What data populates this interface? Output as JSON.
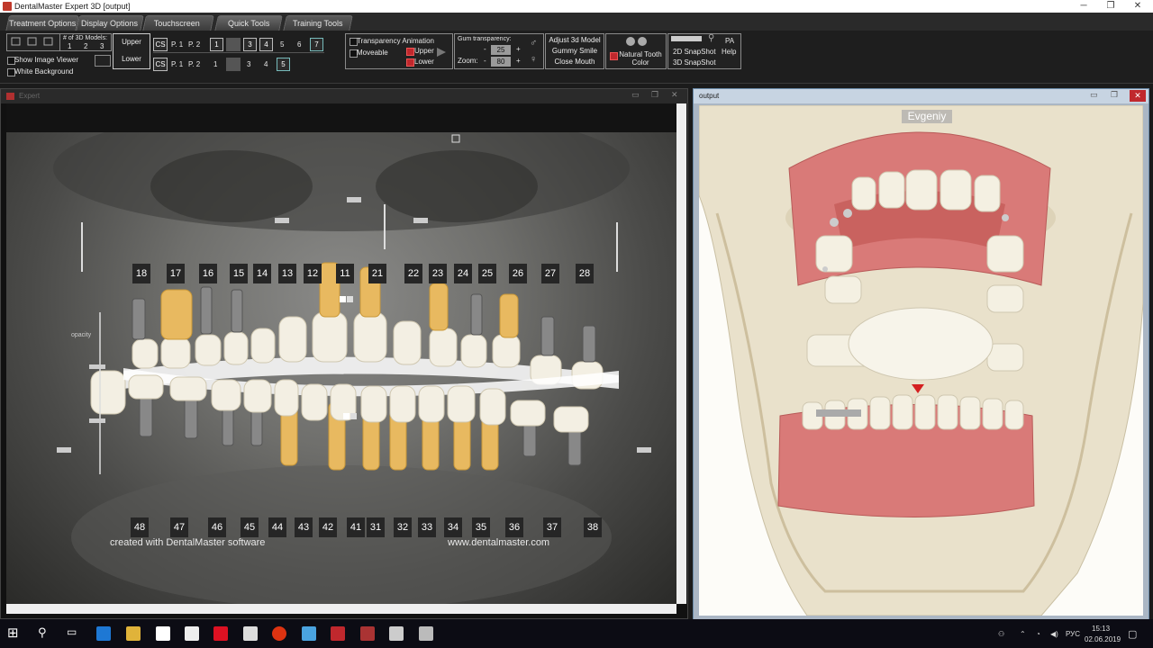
{
  "window": {
    "title": "DentalMaster Expert 3D [output]",
    "minimize": "─",
    "maximize": "❐",
    "close": "✕"
  },
  "tabs": [
    "Treatment Options",
    "Display Options",
    "Touchscreen Tools",
    "Quick Tools",
    "Training Tools"
  ],
  "toolbar": {
    "models_label": "# of 3D Models:",
    "models": [
      "1",
      "2",
      "3"
    ],
    "show_image_viewer": "Show Image Viewer",
    "white_background": "White Background",
    "upper": "Upper",
    "lower": "Lower",
    "row1": {
      "cs": "CS",
      "p1": "P. 1",
      "p2": "P. 2",
      "nums": [
        "1",
        "",
        "3",
        "4",
        "5",
        "6",
        "7"
      ]
    },
    "row2": {
      "cs": "CS",
      "p1": "P. 1",
      "p2": "P. 2",
      "nums": [
        "1",
        "",
        "3",
        "4",
        "5"
      ]
    },
    "transparency_animation": "Transparency Animation",
    "moveable": "Moveable",
    "anim_upper": "Upper",
    "anim_lower": "Lower",
    "gum_transparency": "Gum transparency:",
    "gum_value": "25",
    "zoom": "Zoom:",
    "zoom_value": "80",
    "minus": "-",
    "plus": "+",
    "adjust_3d": "Adjust 3d Model",
    "gummy_smile": "Gummy Smile",
    "close_mouth": "Close Mouth",
    "natural_tooth_color": "Natural Tooth Color",
    "pa": "PA",
    "snapshot_2d": "2D SnapShot",
    "snapshot_3d": "3D SnapShot",
    "help": "Help"
  },
  "left_window": {
    "title": "Expert",
    "opacity_label": "opacity",
    "upper_teeth": [
      "18",
      "17",
      "16",
      "15",
      "14",
      "13",
      "12",
      "11",
      "21",
      "22",
      "23",
      "24",
      "25",
      "26",
      "27",
      "28"
    ],
    "lower_teeth": [
      "48",
      "47",
      "46",
      "45",
      "44",
      "43",
      "42",
      "41",
      "31",
      "32",
      "33",
      "34",
      "35",
      "36",
      "37",
      "38"
    ],
    "watermark_left": "created with DentalMaster software",
    "watermark_right": "www.dentalmaster.com"
  },
  "right_window": {
    "title": "output",
    "patient_name": "Evgeniy"
  },
  "taskbar": {
    "time": "15:13",
    "date": "02.06.2019",
    "lang": "РУС"
  },
  "colors": {
    "accent_red": "#c0282d",
    "toolbar_bg": "#1e1e1e",
    "gum": "#d97a78",
    "skull": "#e9e1cb",
    "tooth": "#f4f0e2"
  }
}
